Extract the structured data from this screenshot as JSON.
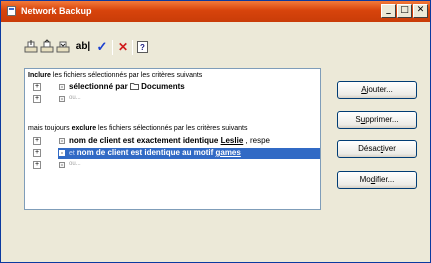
{
  "window": {
    "title": "Network Backup",
    "minimize_glyph": "_",
    "maximize_glyph": "□",
    "close_glyph": "✕"
  },
  "toolbar": {
    "tools": [
      {
        "name": "add-rule-icon"
      },
      {
        "name": "add-rule-up-icon"
      },
      {
        "name": "add-rule-down-icon"
      },
      {
        "name": "rename-icon",
        "text": "ab|"
      },
      {
        "name": "checkmark-icon",
        "text": "✓",
        "color": "#1a3fd0"
      },
      {
        "name": "delete-icon",
        "text": "✕",
        "color": "#d01a1a"
      },
      {
        "name": "help-icon",
        "text": "?"
      }
    ]
  },
  "rules": {
    "include_header": {
      "bold": "Inclure",
      "rest": " les fichiers sélectionnés par les critères suivants"
    },
    "include_criterion": {
      "text": "sélectionné par",
      "folder": "Documents"
    },
    "exclude_header": {
      "prefix": "mais toujours ",
      "bold": "exclure",
      "rest": " les fichiers sélectionnés par les critères suivants"
    },
    "exclude_criterion_1": {
      "text": "nom de client est exactement identique ",
      "link": "Leslie",
      "rest": " , respe"
    },
    "exclude_criterion_2": {
      "prefix": "et ",
      "text": "nom de client est identique au motif ",
      "link": "games"
    },
    "ou_label": "ou..."
  },
  "buttons": {
    "add": {
      "pre": "",
      "key": "A",
      "post": "jouter..."
    },
    "remove": {
      "pre": "S",
      "key": "u",
      "post": "pprimer..."
    },
    "disable": {
      "pre": "Désac",
      "key": "t",
      "post": "iver"
    },
    "modify": {
      "pre": "Mo",
      "key": "d",
      "post": "ifier..."
    }
  },
  "colors": {
    "title_bar": "#d8440c",
    "selection": "#316ac5",
    "button_border": "#003c74"
  }
}
